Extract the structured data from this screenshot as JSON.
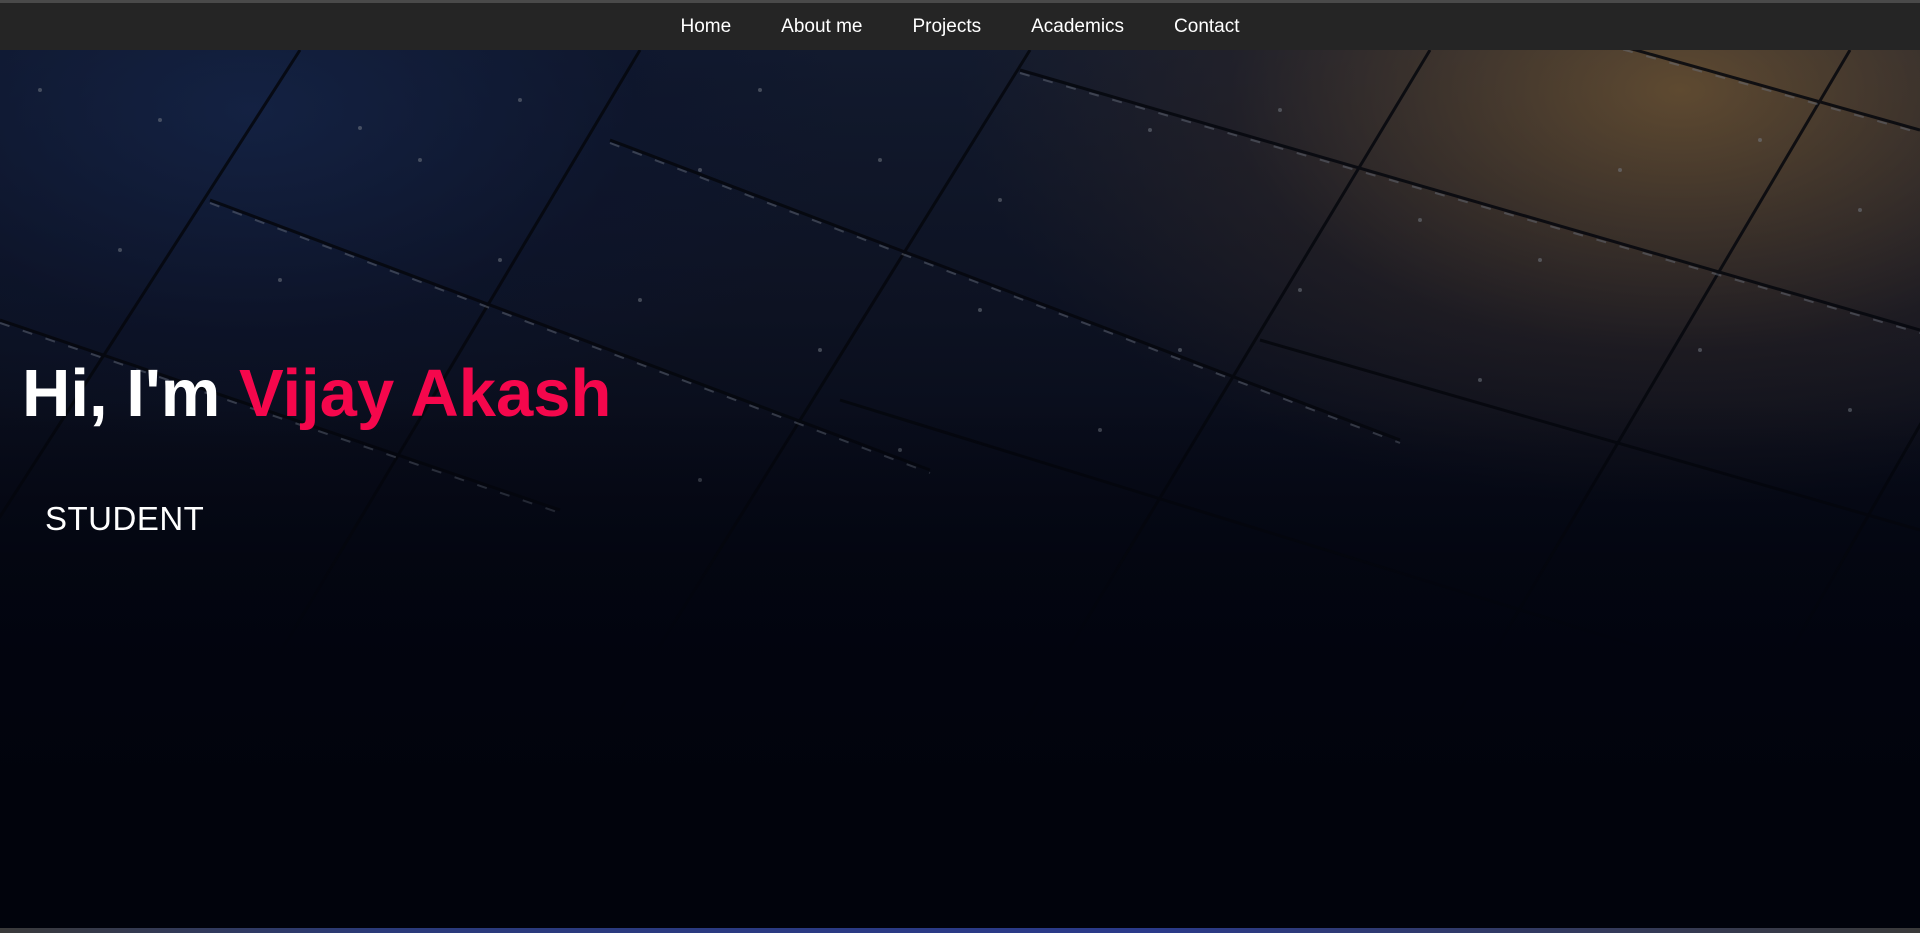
{
  "nav": {
    "items": [
      {
        "label": "Home"
      },
      {
        "label": "About me"
      },
      {
        "label": "Projects"
      },
      {
        "label": "Academics"
      },
      {
        "label": "Contact"
      }
    ]
  },
  "hero": {
    "greeting_prefix": "Hi, I'm ",
    "name": "Vijay Akash",
    "role": "STUDENT",
    "background_image": "dark-metal-panels"
  },
  "colors": {
    "accent": "#f5074c",
    "navbar": "#252525",
    "background": "#020512",
    "text": "#ffffff"
  }
}
